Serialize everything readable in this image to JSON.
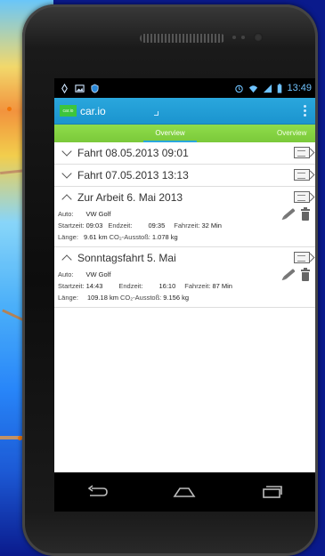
{
  "status_bar": {
    "time": "13:49",
    "left_icons": [
      "usb-icon",
      "image-icon",
      "shield-icon"
    ],
    "right_icons": [
      "alarm-icon",
      "wifi-icon",
      "signal-icon",
      "battery-icon"
    ]
  },
  "action_bar": {
    "logo_text": "car.io",
    "title": "car.io"
  },
  "tabs": {
    "active": "Overview",
    "next": "Overview"
  },
  "trips": [
    {
      "title": "Fahrt 08.05.2013 09:01",
      "expanded": false
    },
    {
      "title": "Fahrt 07.05.2013 13:13",
      "expanded": false
    },
    {
      "title": "Zur Arbeit 6. Mai 2013",
      "expanded": true,
      "auto_label": "Auto:",
      "auto_value": "VW Golf",
      "start_label": "Startzeit:",
      "start_value": "09:03",
      "end_label": "Endzeit:",
      "end_value": "09:35",
      "duration_label": "Fahrzeit:",
      "duration_value": "32 Min",
      "length_label": "Länge:",
      "length_value": "9.61 km",
      "co2_label": "CO₂-Ausstoß:",
      "co2_value": "1.078 kg"
    },
    {
      "title": "Sonntagsfahrt 5. Mai",
      "expanded": true,
      "auto_label": "Auto:",
      "auto_value": "VW Golf",
      "start_label": "Startzeit:",
      "start_value": "14:43",
      "end_label": "Endzeit:",
      "end_value": "16:10",
      "duration_label": "Fahrzeit:",
      "duration_value": "87 Min",
      "length_label": "Länge:",
      "length_value": "109.18 km",
      "co2_label": "CO₂-Ausstoß:",
      "co2_value": "9.156 kg"
    }
  ],
  "nav": [
    "back-icon",
    "home-icon",
    "recents-icon"
  ],
  "colors": {
    "action_bar": "#1b94cf",
    "tab_bar": "#7bc93a",
    "app_logo": "#3dc53d",
    "clock": "#6fc3ff"
  }
}
